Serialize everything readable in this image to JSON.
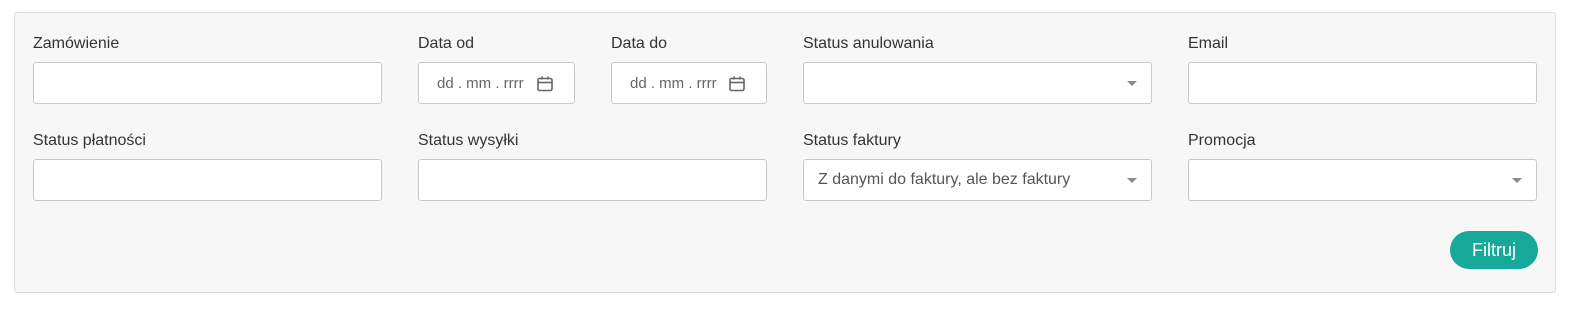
{
  "filters": {
    "order": {
      "label": "Zamówienie",
      "value": ""
    },
    "date_from": {
      "label": "Data od",
      "placeholder": "dd . mm . rrrr"
    },
    "date_to": {
      "label": "Data do",
      "placeholder": "dd . mm . rrrr"
    },
    "cancel_status": {
      "label": "Status anulowania",
      "selected": ""
    },
    "email": {
      "label": "Email",
      "value": ""
    },
    "payment_status": {
      "label": "Status płatności",
      "value": ""
    },
    "shipping_status": {
      "label": "Status wysyłki",
      "value": ""
    },
    "invoice_status": {
      "label": "Status faktury",
      "selected": "Z danymi do faktury, ale bez faktury"
    },
    "promotion": {
      "label": "Promocja",
      "selected": ""
    }
  },
  "actions": {
    "filter_label": "Filtruj"
  },
  "icons": {
    "date_picker": "calendar-icon",
    "dropdown": "chevron-down-icon"
  },
  "colors": {
    "accent": "#17a89a"
  }
}
